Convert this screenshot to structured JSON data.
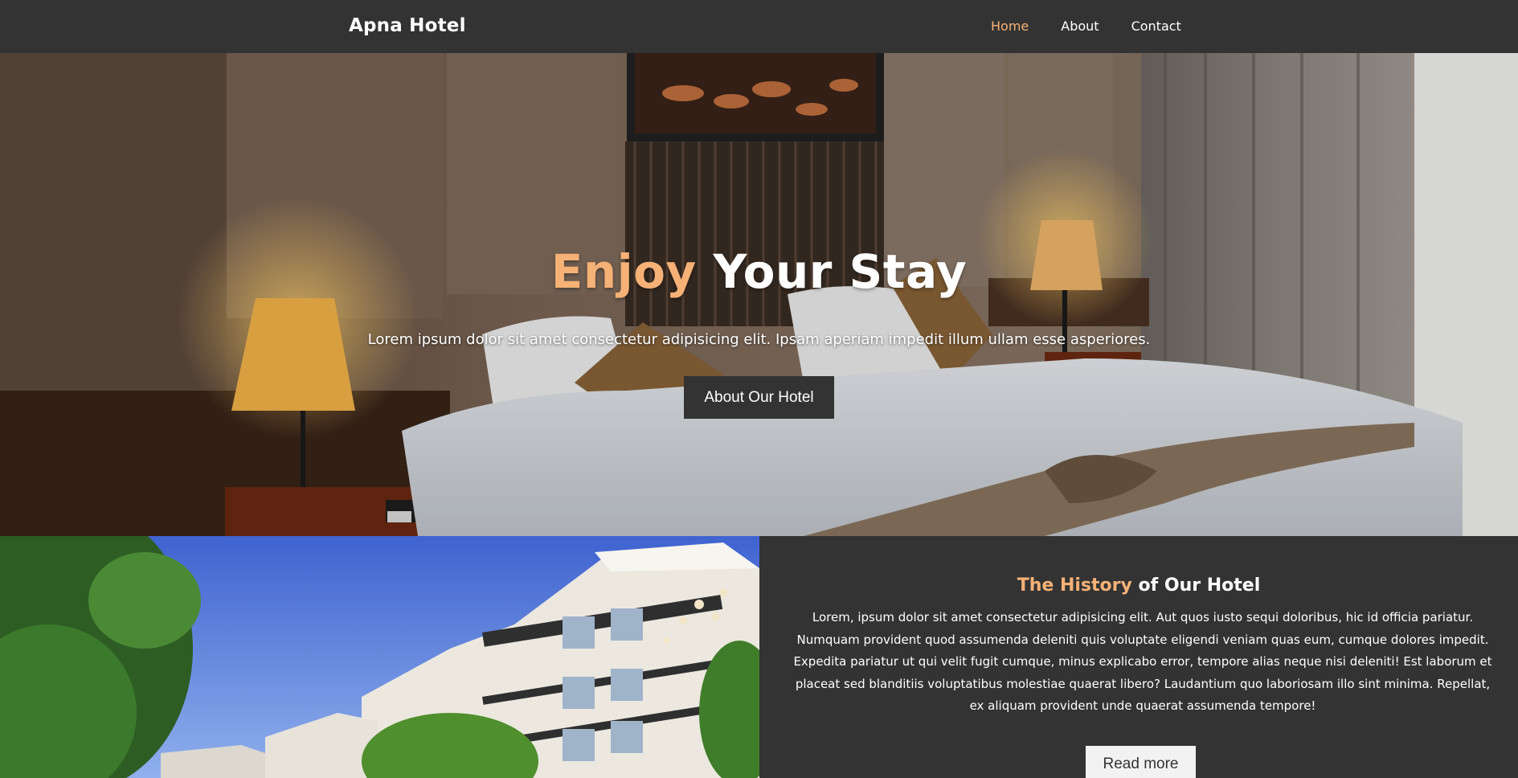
{
  "navbar": {
    "brand": "Apna Hotel",
    "links": [
      {
        "label": "Home",
        "active": true
      },
      {
        "label": "About",
        "active": false
      },
      {
        "label": "Contact",
        "active": false
      }
    ]
  },
  "hero": {
    "title_accent": "Enjoy",
    "title_rest": " Your Stay",
    "subtitle": "Lorem ipsum dolor sit amet consectetur adipisicing elit. Ipsam aperiam impedit illum ullam esse asperiores.",
    "button_label": "About Our Hotel"
  },
  "history": {
    "title_accent": "The History",
    "title_rest": " of Our Hotel",
    "body": "Lorem, ipsum dolor sit amet consectetur adipisicing elit. Aut quos iusto sequi doloribus, hic id officia pariatur. Numquam provident quod assumenda deleniti quis voluptate eligendi veniam quas eum, cumque dolores impedit. Expedita pariatur ut qui velit fugit cumque, minus explicabo error, tempore alias neque nisi deleniti! Est laborum et placeat sed blanditiis voluptatibus molestiae quaerat libero? Laudantium quo laboriosam illo sint minima. Repellat, ex aliquam provident unde quaerat assumenda tempore!",
    "button_label": "Read more"
  },
  "colors": {
    "accent": "#f6b176",
    "dark_bg": "#333333",
    "light_button": "#f2f2f2"
  }
}
